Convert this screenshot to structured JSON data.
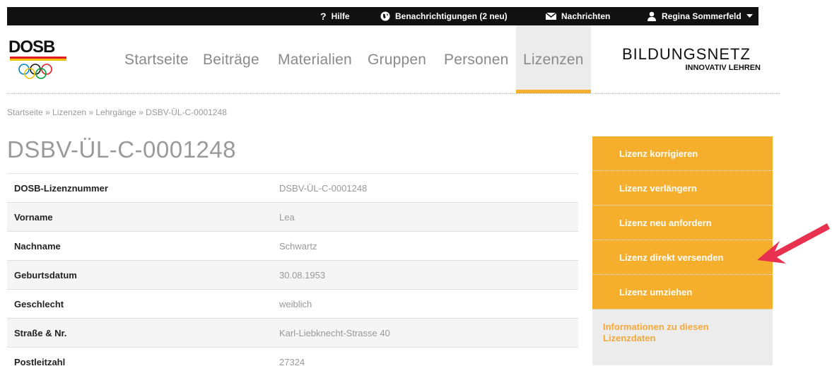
{
  "topbar": {
    "help_label": "Hilfe",
    "notifications_label": "Benachrichtigungen (2 neu)",
    "messages_label": "Nachrichten",
    "user_name": "Regina Sommerfeld"
  },
  "logo": {
    "text": "DOSB"
  },
  "nav": {
    "items": [
      {
        "label": "Startseite"
      },
      {
        "label": "Beiträge"
      },
      {
        "label": "Materialien"
      },
      {
        "label": "Gruppen"
      },
      {
        "label": "Personen"
      },
      {
        "label": "Lizenzen",
        "active": true
      }
    ]
  },
  "brand": {
    "line1": "BILDUNGSNETZ",
    "line2": "INNOVATIV LEHREN"
  },
  "breadcrumb": "Startseite » Lizenzen » Lehrgänge » DSBV-ÜL-C-0001248",
  "page_title": "DSBV-ÜL-C-0001248",
  "details": [
    {
      "label": "DOSB-Lizenznummer",
      "value": "DSBV-ÜL-C-0001248"
    },
    {
      "label": "Vorname",
      "value": "Lea"
    },
    {
      "label": "Nachname",
      "value": "Schwartz"
    },
    {
      "label": "Geburtsdatum",
      "value": "30.08.1953"
    },
    {
      "label": "Geschlecht",
      "value": "weiblich"
    },
    {
      "label": "Straße & Nr.",
      "value": "Karl-Liebknecht-Strasse 40"
    },
    {
      "label": "Postleitzahl",
      "value": "27324"
    }
  ],
  "sidebar": {
    "actions": [
      {
        "label": "Lizenz korrigieren"
      },
      {
        "label": "Lizenz verlängern"
      },
      {
        "label": "Lizenz neu anfordern"
      },
      {
        "label": "Lizenz direkt versenden"
      },
      {
        "label": "Lizenz umziehen"
      }
    ],
    "info_label": "Informationen zu diesen Lizenzdaten"
  },
  "colors": {
    "accent": "#f6ae2d",
    "topbar": "#111111",
    "arrow": "#e8314f"
  }
}
